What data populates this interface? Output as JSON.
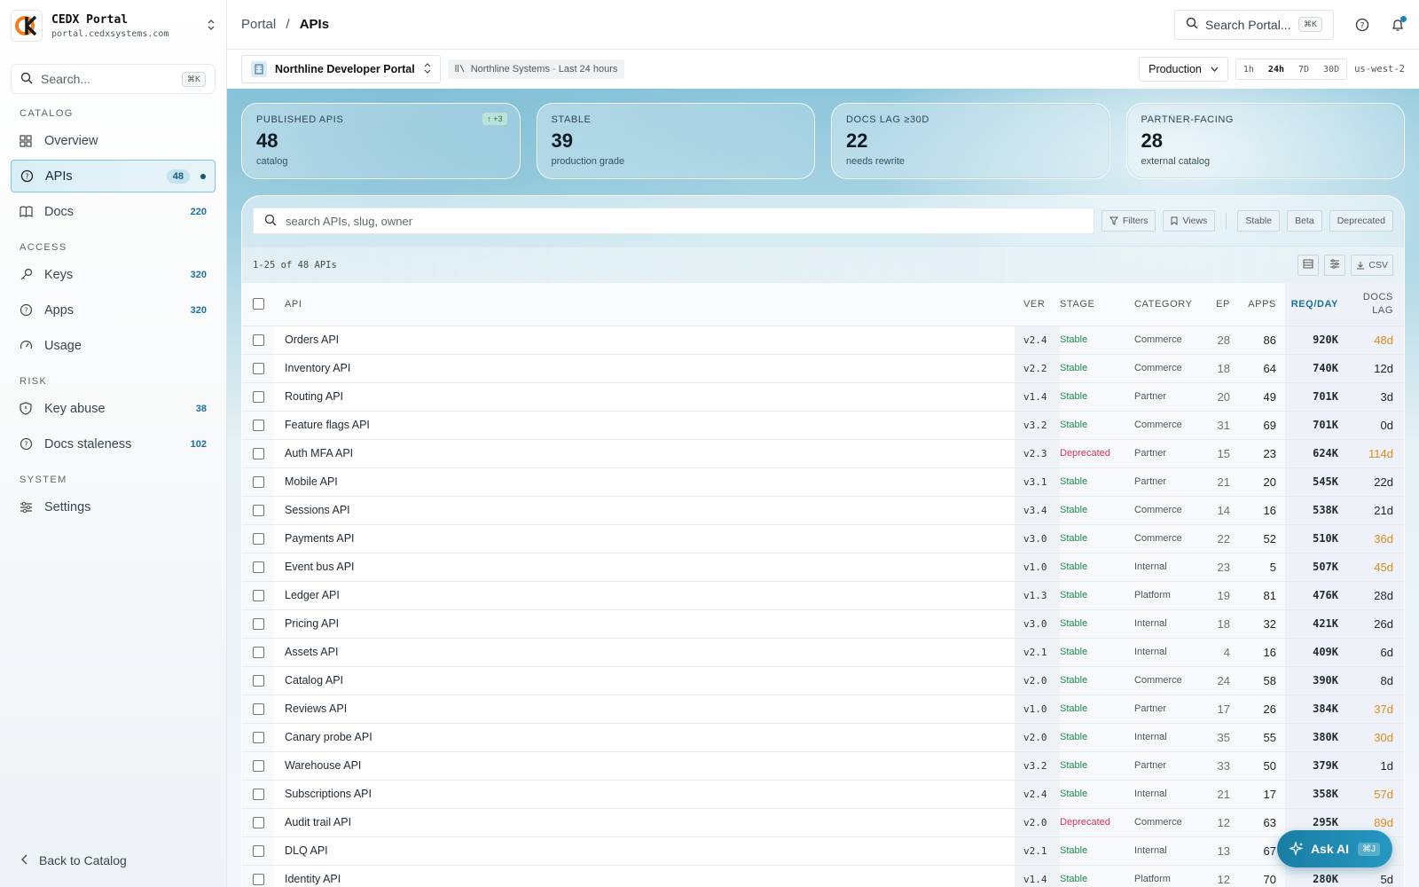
{
  "brand": {
    "name": "CEDX Portal",
    "domain": "portal.cedxsystems.com"
  },
  "sidebar": {
    "search_placeholder": "Search...",
    "search_kbd": "⌘K",
    "sections": [
      {
        "label": "CATALOG",
        "items": [
          {
            "label": "Overview",
            "icon": "grid-icon",
            "count": ""
          },
          {
            "label": "APIs",
            "icon": "api-icon",
            "count": "48",
            "active": true
          },
          {
            "label": "Docs",
            "icon": "book-icon",
            "count": "220"
          }
        ]
      },
      {
        "label": "ACCESS",
        "items": [
          {
            "label": "Keys",
            "icon": "key-icon",
            "count": "320"
          },
          {
            "label": "Apps",
            "icon": "apps-icon",
            "count": "320"
          },
          {
            "label": "Usage",
            "icon": "gauge-icon",
            "count": ""
          }
        ]
      },
      {
        "label": "RISK",
        "items": [
          {
            "label": "Key abuse",
            "icon": "shield-icon",
            "count": "38"
          },
          {
            "label": "Docs staleness",
            "icon": "alert-icon",
            "count": "102"
          }
        ]
      },
      {
        "label": "SYSTEM",
        "items": [
          {
            "label": "Settings",
            "icon": "sliders-icon",
            "count": ""
          }
        ]
      }
    ],
    "back_label": "Back to Catalog"
  },
  "topbar": {
    "crumb_root": "Portal",
    "crumb_sep": "/",
    "crumb_current": "APIs",
    "search_placeholder": "Search Portal...",
    "search_kbd": "⌘K"
  },
  "context": {
    "portal": "Northline Developer Portal",
    "org_chip": "Northline Systems · Last 24 hours",
    "environment": "Production",
    "ranges": [
      "1h",
      "24h",
      "7D",
      "30D"
    ],
    "active_range": "24h",
    "region": "us-west-2"
  },
  "stats": [
    {
      "label": "PUBLISHED APIS",
      "value": "48",
      "sub": "catalog",
      "delta": "↑ +3"
    },
    {
      "label": "STABLE",
      "value": "39",
      "sub": "production grade",
      "delta": ""
    },
    {
      "label": "DOCS LAG ≥30D",
      "value": "22",
      "sub": "needs rewrite",
      "delta": ""
    },
    {
      "label": "PARTNER-FACING",
      "value": "28",
      "sub": "external catalog",
      "delta": ""
    }
  ],
  "toolbar": {
    "search_placeholder": "search APIs, slug, owner",
    "filters_label": "Filters",
    "views_label": "Views",
    "chips": [
      "Stable",
      "Beta",
      "Deprecated"
    ]
  },
  "subbar": {
    "range_text": "1-25 of 48 APIs",
    "csv_label": "CSV"
  },
  "table": {
    "headers": {
      "api": "API",
      "ver": "VER",
      "stage": "STAGE",
      "category": "CATEGORY",
      "ep": "EP",
      "apps": "APPS",
      "req": "REQ/DAY",
      "lag": "DOCS LAG"
    },
    "rows": [
      {
        "api": "Orders API",
        "ver": "v2.4",
        "stage": "Stable",
        "category": "Commerce",
        "ep": "28",
        "apps": "86",
        "req": "920K",
        "lag": "48d",
        "warn": true
      },
      {
        "api": "Inventory API",
        "ver": "v2.2",
        "stage": "Stable",
        "category": "Commerce",
        "ep": "18",
        "apps": "64",
        "req": "740K",
        "lag": "12d",
        "warn": false
      },
      {
        "api": "Routing API",
        "ver": "v1.4",
        "stage": "Stable",
        "category": "Partner",
        "ep": "20",
        "apps": "49",
        "req": "701K",
        "lag": "3d",
        "warn": false
      },
      {
        "api": "Feature flags API",
        "ver": "v3.2",
        "stage": "Stable",
        "category": "Commerce",
        "ep": "31",
        "apps": "69",
        "req": "701K",
        "lag": "0d",
        "warn": false
      },
      {
        "api": "Auth MFA API",
        "ver": "v2.3",
        "stage": "Deprecated",
        "category": "Partner",
        "ep": "15",
        "apps": "23",
        "req": "624K",
        "lag": "114d",
        "warn": true
      },
      {
        "api": "Mobile API",
        "ver": "v3.1",
        "stage": "Stable",
        "category": "Partner",
        "ep": "21",
        "apps": "20",
        "req": "545K",
        "lag": "22d",
        "warn": false
      },
      {
        "api": "Sessions API",
        "ver": "v3.4",
        "stage": "Stable",
        "category": "Commerce",
        "ep": "14",
        "apps": "16",
        "req": "538K",
        "lag": "21d",
        "warn": false
      },
      {
        "api": "Payments API",
        "ver": "v3.0",
        "stage": "Stable",
        "category": "Commerce",
        "ep": "22",
        "apps": "52",
        "req": "510K",
        "lag": "36d",
        "warn": true
      },
      {
        "api": "Event bus API",
        "ver": "v1.0",
        "stage": "Stable",
        "category": "Internal",
        "ep": "23",
        "apps": "5",
        "req": "507K",
        "lag": "45d",
        "warn": true
      },
      {
        "api": "Ledger API",
        "ver": "v1.3",
        "stage": "Stable",
        "category": "Platform",
        "ep": "19",
        "apps": "81",
        "req": "476K",
        "lag": "28d",
        "warn": false
      },
      {
        "api": "Pricing API",
        "ver": "v3.0",
        "stage": "Stable",
        "category": "Internal",
        "ep": "18",
        "apps": "32",
        "req": "421K",
        "lag": "26d",
        "warn": false
      },
      {
        "api": "Assets API",
        "ver": "v2.1",
        "stage": "Stable",
        "category": "Internal",
        "ep": "4",
        "apps": "16",
        "req": "409K",
        "lag": "6d",
        "warn": false
      },
      {
        "api": "Catalog API",
        "ver": "v2.0",
        "stage": "Stable",
        "category": "Commerce",
        "ep": "24",
        "apps": "58",
        "req": "390K",
        "lag": "8d",
        "warn": false
      },
      {
        "api": "Reviews API",
        "ver": "v1.0",
        "stage": "Stable",
        "category": "Partner",
        "ep": "17",
        "apps": "26",
        "req": "384K",
        "lag": "37d",
        "warn": true
      },
      {
        "api": "Canary probe API",
        "ver": "v2.0",
        "stage": "Stable",
        "category": "Internal",
        "ep": "35",
        "apps": "55",
        "req": "380K",
        "lag": "30d",
        "warn": true
      },
      {
        "api": "Warehouse API",
        "ver": "v3.2",
        "stage": "Stable",
        "category": "Partner",
        "ep": "33",
        "apps": "50",
        "req": "379K",
        "lag": "1d",
        "warn": false
      },
      {
        "api": "Subscriptions API",
        "ver": "v2.4",
        "stage": "Stable",
        "category": "Internal",
        "ep": "21",
        "apps": "17",
        "req": "358K",
        "lag": "57d",
        "warn": true
      },
      {
        "api": "Audit trail API",
        "ver": "v2.0",
        "stage": "Deprecated",
        "category": "Commerce",
        "ep": "12",
        "apps": "63",
        "req": "295K",
        "lag": "89d",
        "warn": true
      },
      {
        "api": "DLQ API",
        "ver": "v2.1",
        "stage": "Stable",
        "category": "Internal",
        "ep": "13",
        "apps": "67",
        "req": "",
        "lag": "",
        "warn": false
      },
      {
        "api": "Identity API",
        "ver": "v1.4",
        "stage": "Stable",
        "category": "Platform",
        "ep": "12",
        "apps": "70",
        "req": "280K",
        "lag": "5d",
        "warn": false
      }
    ]
  },
  "ask_ai": {
    "label": "Ask AI",
    "kbd": "⌘J"
  },
  "colors": {
    "accent": "#1b7da3",
    "stable": "#1f8a4f",
    "deprecated": "#d6335a",
    "lag_warn": "#e08a1c"
  }
}
